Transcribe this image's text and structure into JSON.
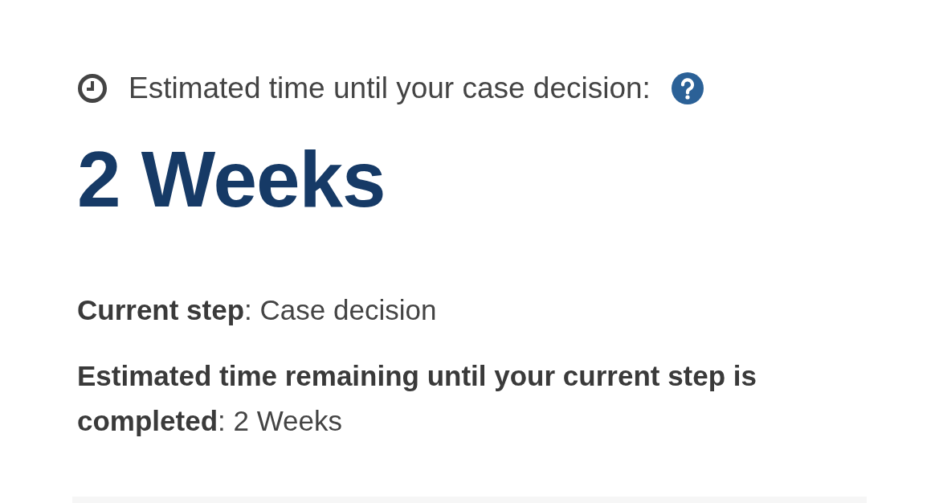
{
  "header": {
    "label": "Estimated time until your case decision:"
  },
  "estimate": "2 Weeks",
  "details": [
    "**Current step**: Case decision",
    "**Estimated time remaining until your current step is completed**: 2 Weeks"
  ]
}
